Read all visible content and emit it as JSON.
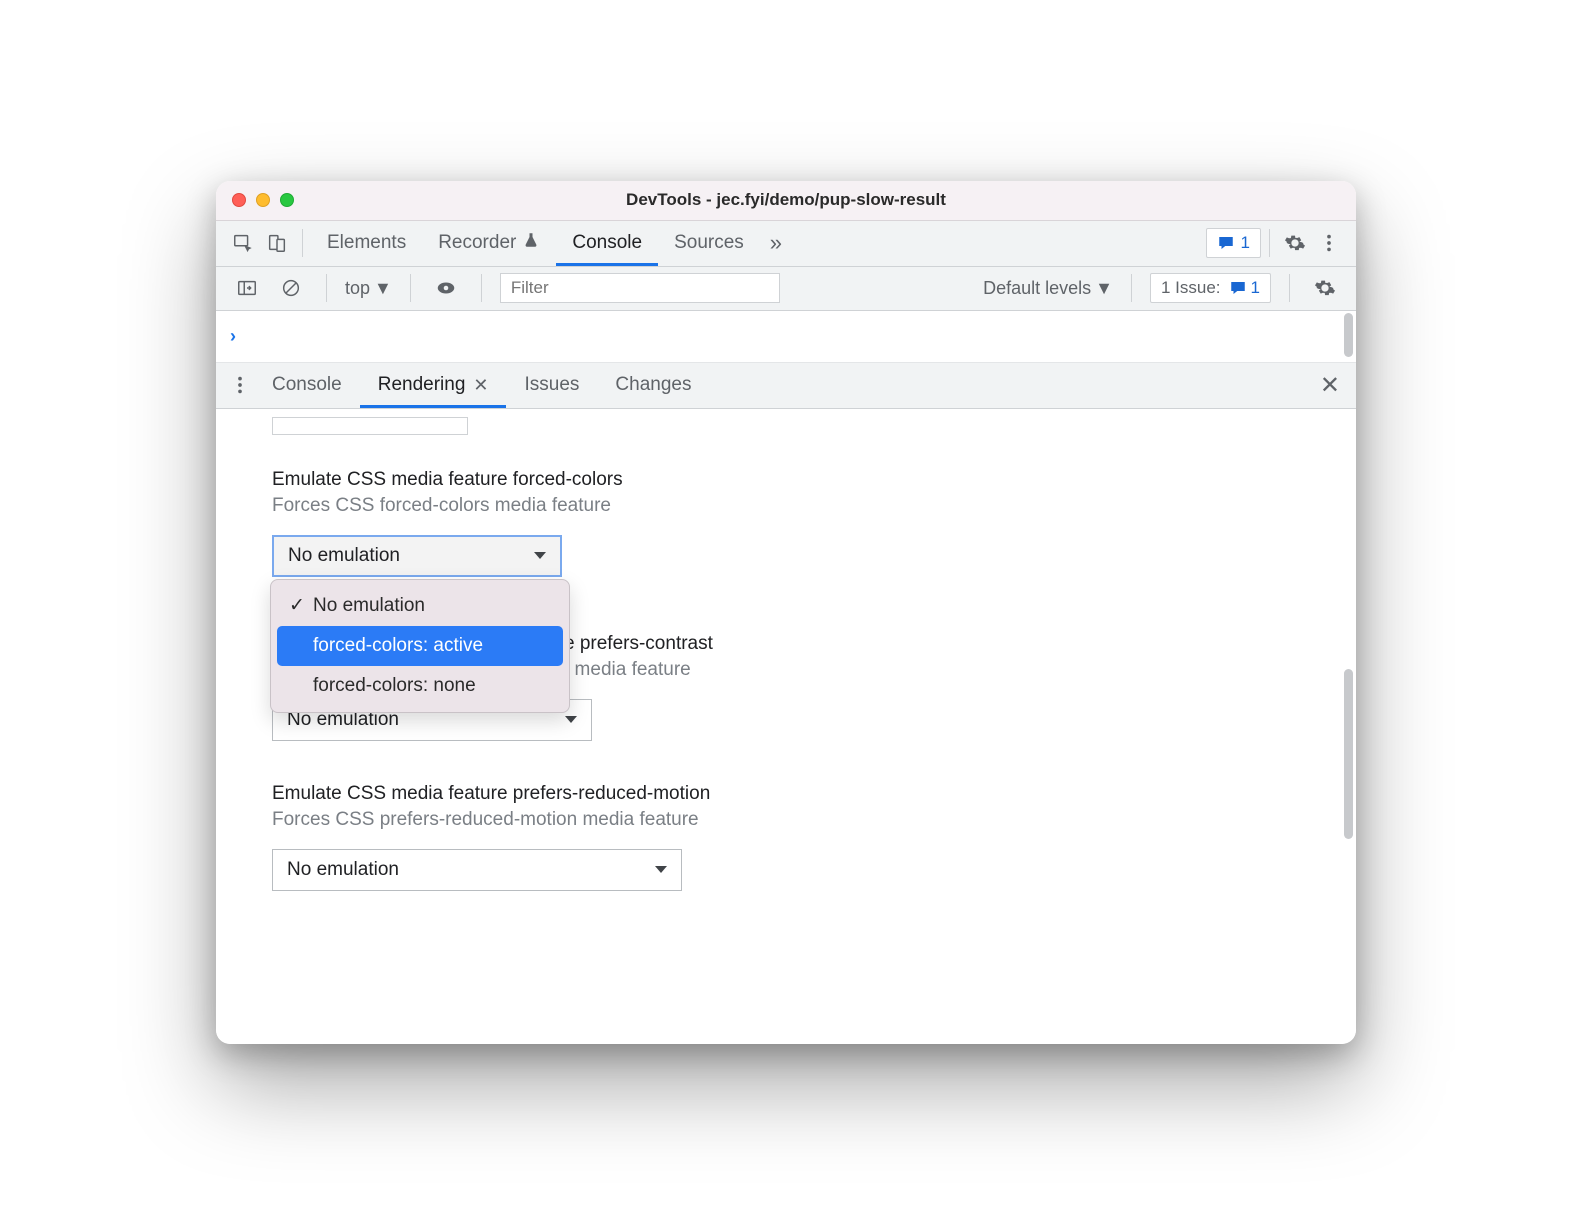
{
  "window": {
    "title": "DevTools - jec.fyi/demo/pup-slow-result"
  },
  "toolbar": {
    "tabs": {
      "elements": "Elements",
      "recorder": "Recorder",
      "console": "Console",
      "sources": "Sources"
    },
    "issue_count": "1"
  },
  "consoleBar": {
    "context": "top",
    "filter_placeholder": "Filter",
    "levels": "Default levels",
    "issues_label": "1 Issue:",
    "issues_count": "1"
  },
  "drawer": {
    "tabs": {
      "console": "Console",
      "rendering": "Rendering",
      "issues": "Issues",
      "changes": "Changes"
    }
  },
  "rendering": {
    "forced_colors": {
      "title": "Emulate CSS media feature forced-colors",
      "subtitle": "Forces CSS forced-colors media feature",
      "selected": "No emulation",
      "options": [
        "No emulation",
        "forced-colors: active",
        "forced-colors: none"
      ]
    },
    "prefers_contrast": {
      "title_suffix": "e prefers-contrast",
      "subtitle_suffix": "t media feature",
      "selected": "No emulation"
    },
    "prefers_reduced_motion": {
      "title": "Emulate CSS media feature prefers-reduced-motion",
      "subtitle": "Forces CSS prefers-reduced-motion media feature",
      "selected": "No emulation"
    }
  }
}
